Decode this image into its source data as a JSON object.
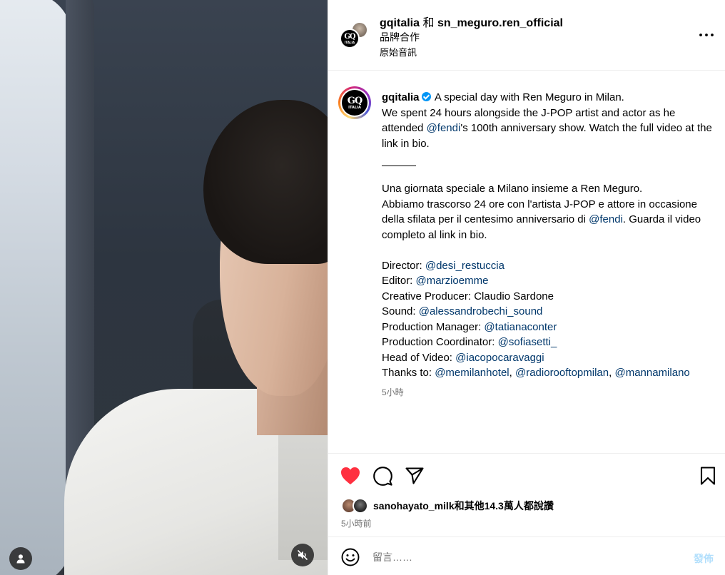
{
  "header": {
    "author": "gqitalia",
    "conjunction": "和",
    "coauthor": "sn_meguro.ren_official",
    "partnership_label": "品牌合作",
    "audio_label": "原始音訊",
    "logo_text": "GQ",
    "logo_subtext": "ITALIA"
  },
  "caption": {
    "username": "gqitalia",
    "verified": true,
    "line1": "A special day with Ren Meguro in Milan.",
    "en_p1_a": "We spent 24 hours alongside the J-POP artist and actor as he attended ",
    "en_mention": "@fendi",
    "en_p1_b": "'s 100th anniversary show. Watch the full video at the link in bio.",
    "it_line1": "Una giornata speciale a Milano insieme a Ren Meguro.",
    "it_p2_a": "Abbiamo trascorso 24 ore con l'artista J-POP e attore in occasione della sfilata per il centesimo anniversario di ",
    "it_mention": "@fendi",
    "it_p2_b": ". Guarda il video completo al link in bio.",
    "credits": [
      {
        "role": "Director: ",
        "handles": [
          "@desi_restuccia"
        ]
      },
      {
        "role": "Editor: ",
        "handles": [
          "@marzioemme"
        ]
      },
      {
        "role": "Creative Producer: Claudio Sardone",
        "handles": []
      },
      {
        "role": "Sound: ",
        "handles": [
          "@alessandrobechi_sound"
        ]
      },
      {
        "role": "Production Manager: ",
        "handles": [
          "@tatianaconter"
        ]
      },
      {
        "role": "Production Coordinator: ",
        "handles": [
          "@sofiasetti_"
        ]
      },
      {
        "role": "Head of Video: ",
        "handles": [
          "@iacopocaravaggi"
        ]
      },
      {
        "role": "Thanks to: ",
        "handles": [
          "@memilanhotel",
          "@radiorooftopmilan",
          "@mannamilano"
        ]
      }
    ],
    "time": "5小時"
  },
  "actions": {
    "icons": [
      "heart-filled-icon",
      "comment-icon",
      "share-icon",
      "bookmark-icon"
    ],
    "liked": true,
    "likes_text": "sanohayato_milk和其他14.3萬人都說讚",
    "time": "5小時前"
  },
  "comment": {
    "placeholder": "留言……",
    "post_label": "發佈"
  },
  "colors": {
    "like_red": "#ff3040",
    "mention_blue": "#00376b",
    "verified_blue": "#0095f6",
    "post_disabled": "#b2dffc",
    "muted_text": "#737373"
  }
}
